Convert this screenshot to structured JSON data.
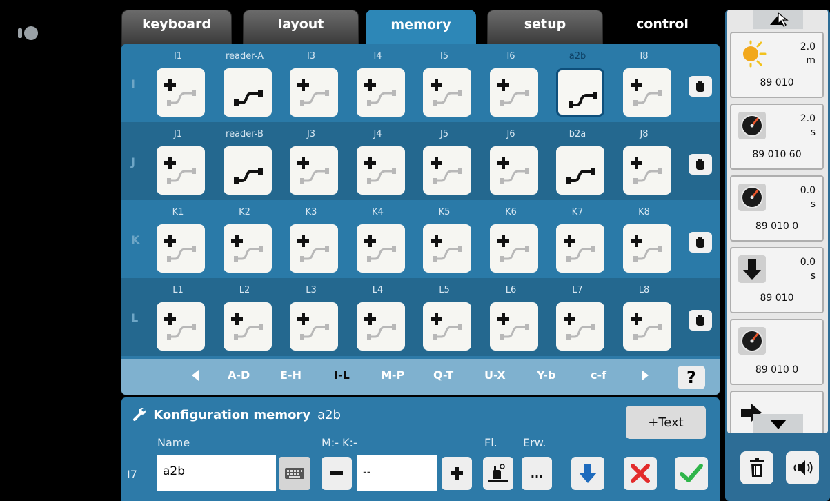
{
  "tabs": [
    {
      "label": "keyboard",
      "active": false
    },
    {
      "label": "layout",
      "active": false
    },
    {
      "label": "memory",
      "active": true
    },
    {
      "label": "setup",
      "active": false
    },
    {
      "label": "control",
      "active": false
    }
  ],
  "grid": {
    "rows": [
      {
        "letter": "I",
        "cells": [
          {
            "label": "I1",
            "type": "add"
          },
          {
            "label": "reader-A",
            "type": "link"
          },
          {
            "label": "I3",
            "type": "add"
          },
          {
            "label": "I4",
            "type": "add"
          },
          {
            "label": "I5",
            "type": "add"
          },
          {
            "label": "I6",
            "type": "add"
          },
          {
            "label": "a2b",
            "type": "link",
            "selected": true
          },
          {
            "label": "I8",
            "type": "add"
          }
        ]
      },
      {
        "letter": "J",
        "cells": [
          {
            "label": "J1",
            "type": "add"
          },
          {
            "label": "reader-B",
            "type": "link"
          },
          {
            "label": "J3",
            "type": "add"
          },
          {
            "label": "J4",
            "type": "add"
          },
          {
            "label": "J5",
            "type": "add"
          },
          {
            "label": "J6",
            "type": "add"
          },
          {
            "label": "b2a",
            "type": "link"
          },
          {
            "label": "J8",
            "type": "add"
          }
        ]
      },
      {
        "letter": "K",
        "cells": [
          {
            "label": "K1",
            "type": "add"
          },
          {
            "label": "K2",
            "type": "add"
          },
          {
            "label": "K3",
            "type": "add"
          },
          {
            "label": "K4",
            "type": "add"
          },
          {
            "label": "K5",
            "type": "add"
          },
          {
            "label": "K6",
            "type": "add"
          },
          {
            "label": "K7",
            "type": "add"
          },
          {
            "label": "K8",
            "type": "add"
          }
        ]
      },
      {
        "letter": "L",
        "cells": [
          {
            "label": "L1",
            "type": "add"
          },
          {
            "label": "L2",
            "type": "add"
          },
          {
            "label": "L3",
            "type": "add"
          },
          {
            "label": "L4",
            "type": "add"
          },
          {
            "label": "L5",
            "type": "add"
          },
          {
            "label": "L6",
            "type": "add"
          },
          {
            "label": "L7",
            "type": "add"
          },
          {
            "label": "L8",
            "type": "add"
          }
        ]
      }
    ]
  },
  "nav": {
    "pages": [
      "A-D",
      "E-H",
      "I-L",
      "M-P",
      "Q-T",
      "U-X",
      "Y-b",
      "c-f"
    ],
    "current": "I-L",
    "help": "?"
  },
  "config": {
    "title": "Konfiguration memory",
    "item_name": "a2b",
    "text_button": "+Text",
    "name_label": "Name",
    "mk_label": "M:- K:-",
    "fl_label": "Fl.",
    "erw_label": "Erw.",
    "row_id": "I7",
    "name_value": "a2b",
    "mk_value": "--",
    "erw_button": "..."
  },
  "sidebar": {
    "tiles": [
      {
        "icon": "sun-icon",
        "value_line1": "2.0",
        "value_line2": "m",
        "code": "89 010"
      },
      {
        "icon": "gauge-icon",
        "value_line1": "2.0",
        "value_line2": "s",
        "code": "89 010 60"
      },
      {
        "icon": "gauge-icon",
        "value_line1": "0.0",
        "value_line2": "s",
        "code": "89 010 0"
      },
      {
        "icon": "arrow-down-icon",
        "value_line1": "0.0",
        "value_line2": "s",
        "code": "89 010"
      },
      {
        "icon": "gauge-icon",
        "value_line1": "",
        "value_line2": "",
        "code": "89 010 0"
      },
      {
        "icon": "arrow-right-icon",
        "value_line1": "",
        "value_line2": "",
        "code": ""
      }
    ]
  },
  "colors": {
    "panel": "#2d7aa8",
    "row_dark": "#24688f",
    "nav_bar": "#7fb1cf",
    "selected_border": "#0e4f7b",
    "accept_green": "#2fb54a",
    "cancel_red": "#e32b2b",
    "download_blue": "#1e6bbd"
  }
}
